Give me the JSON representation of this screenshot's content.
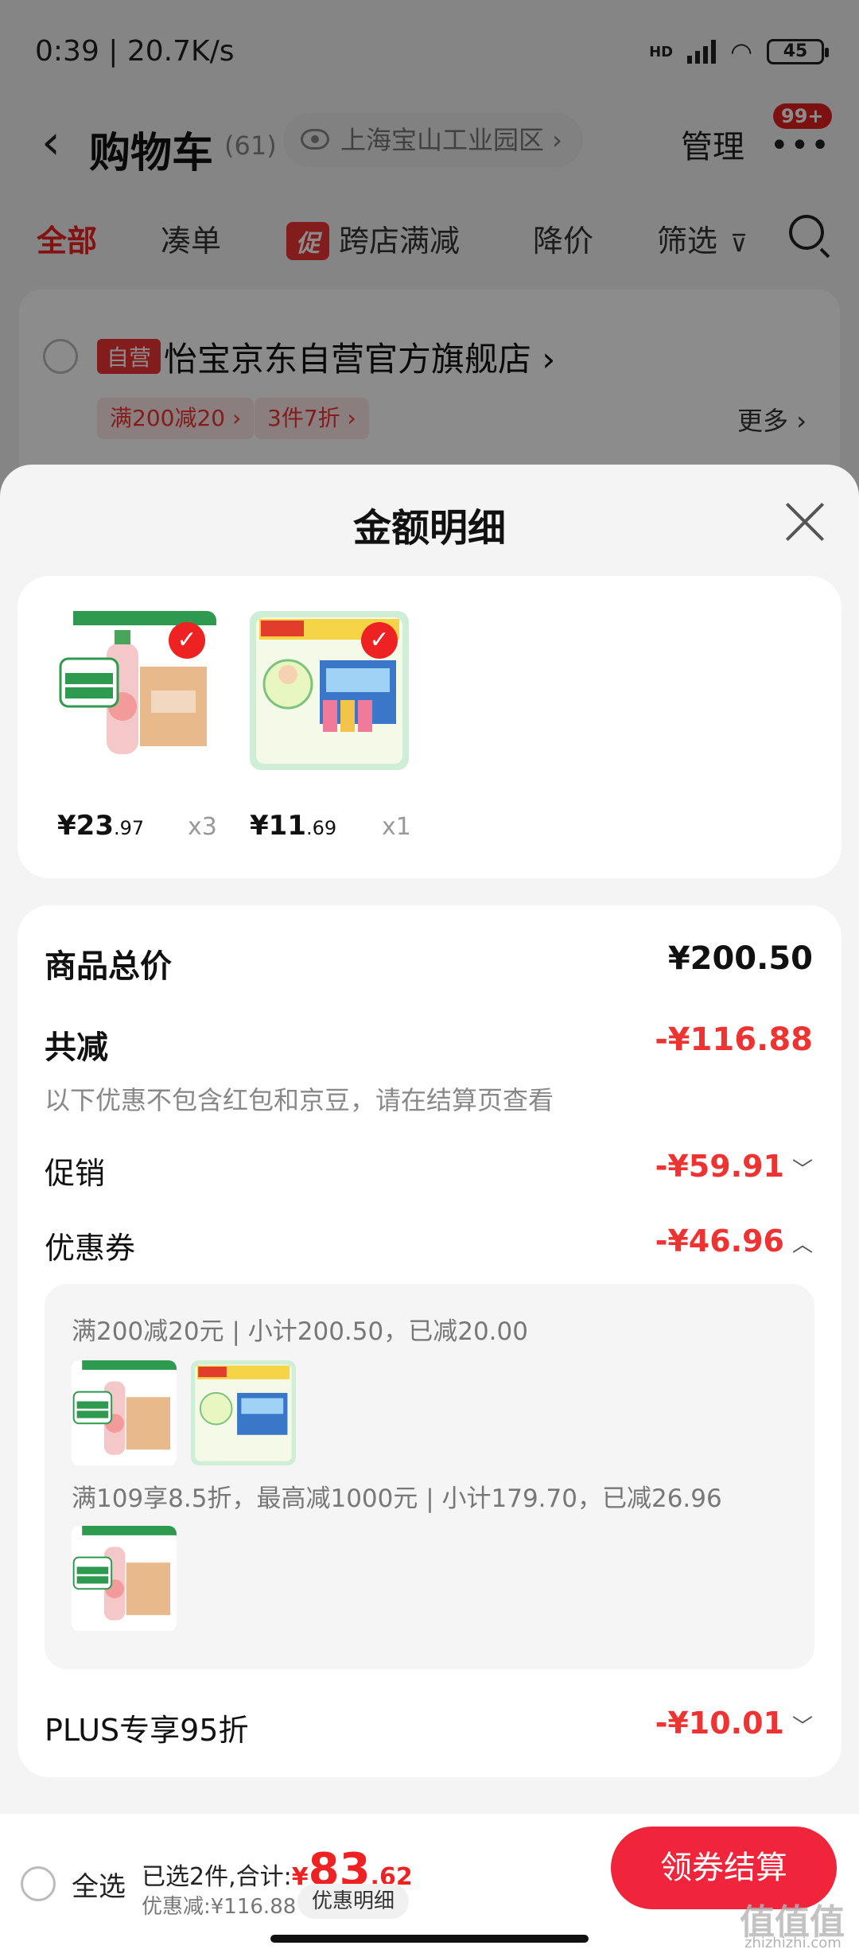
{
  "status_bar": {
    "time": "0:39",
    "speed": "20.7K/s",
    "network": "HD",
    "battery": "45"
  },
  "nav": {
    "title": "购物车",
    "count": "(61)",
    "location": "上海宝山工业园区 ›",
    "manage": "管理",
    "badge": "99+"
  },
  "tabs": {
    "all": "全部",
    "combine": "凑单",
    "promo_tag": "促",
    "cross_store": "跨店满减",
    "price_drop": "降价",
    "filter": "筛选"
  },
  "store": {
    "tag": "自营",
    "name": "怡宝京东自营官方旗舰店 ›",
    "coupon1": "满200减20 ›",
    "coupon2": "3件7折 ›",
    "more": "更多 ›"
  },
  "sheet": {
    "title": "金额明细",
    "items": [
      {
        "price_main": "¥23",
        "price_dec": ".97",
        "qty": "x3"
      },
      {
        "price_main": "¥11",
        "price_dec": ".69",
        "qty": "x1"
      }
    ],
    "total_label": "商品总价",
    "total_value": "¥200.50",
    "saved_label": "共减",
    "saved_value": "-¥116.88",
    "note": "以下优惠不包含红包和京豆，请在结算页查看",
    "promo_label": "促销",
    "promo_value": "-¥59.91",
    "coupon_label": "优惠券",
    "coupon_value": "-¥46.96",
    "coupon_line1": "满200减20元 | 小计200.50，已减20.00",
    "coupon_line2": "满109享8.5折，最高减1000元 | 小计179.70，已减26.96",
    "plus_label": "PLUS专享95折",
    "plus_value": "-¥10.01"
  },
  "bottom": {
    "select_all": "全选",
    "summary_prefix": "已选2件,合计:",
    "yen": "¥",
    "total_int": "83",
    "total_dec": ".62",
    "discount": "优惠减:¥116.88",
    "detail_btn": "优惠明细",
    "checkout": "领券结算"
  },
  "watermark": {
    "main": "值值值",
    "sub": "zhizhizhi.com"
  },
  "colors": {
    "accent": "#e33333",
    "checkout": "#f0243a",
    "overlay": "rgba(0,0,0,0.45)"
  }
}
